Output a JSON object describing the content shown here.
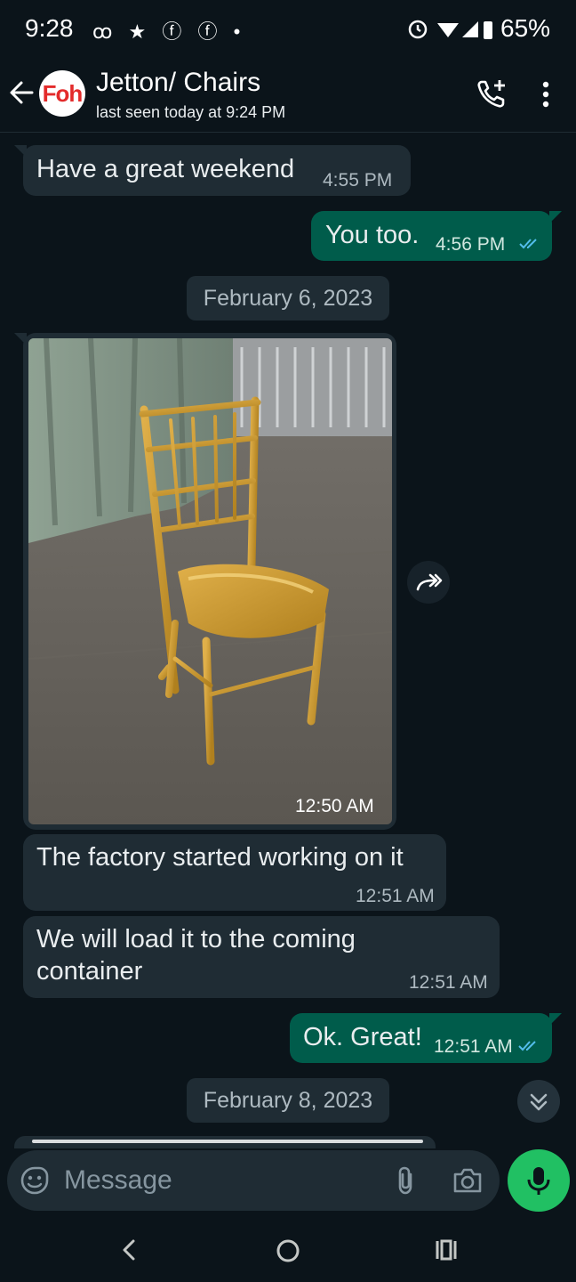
{
  "status_bar": {
    "time": "9:28",
    "left_icons": "ꝏ ★ ⓕ ⓕ •",
    "battery": "65%"
  },
  "header": {
    "avatar_text": "Foh",
    "contact_name": "Jetton/ Chairs",
    "contact_status": "last seen today at 9:24 PM"
  },
  "messages": [
    {
      "dir": "in",
      "text": "Have a great weekend",
      "time": "4:55 PM"
    },
    {
      "dir": "out",
      "text": "You too.",
      "time": "4:56 PM",
      "read": true
    },
    {
      "date_separator": "February 6, 2023"
    },
    {
      "dir": "in",
      "type": "image",
      "image": "gold-chiavari-chair-photo",
      "time": "12:50 AM"
    },
    {
      "dir": "in",
      "text": "The factory started working on it",
      "time": "12:51 AM"
    },
    {
      "dir": "in",
      "text_lines": [
        "We will load it to the coming",
        "container"
      ],
      "time": "12:51 AM"
    },
    {
      "dir": "out",
      "text": "Ok. Great!",
      "time": "12:51 AM",
      "read": true
    },
    {
      "date_separator": "February 8, 2023"
    }
  ],
  "date_1": "February 6, 2023",
  "date_2": "February 8, 2023",
  "input": {
    "placeholder": "Message"
  },
  "colors": {
    "background": "#0b141a",
    "incoming_bubble": "#1f2c34",
    "outgoing_bubble": "#005c4b",
    "read_tick": "#53bdeb",
    "mic_button": "#21c063"
  }
}
